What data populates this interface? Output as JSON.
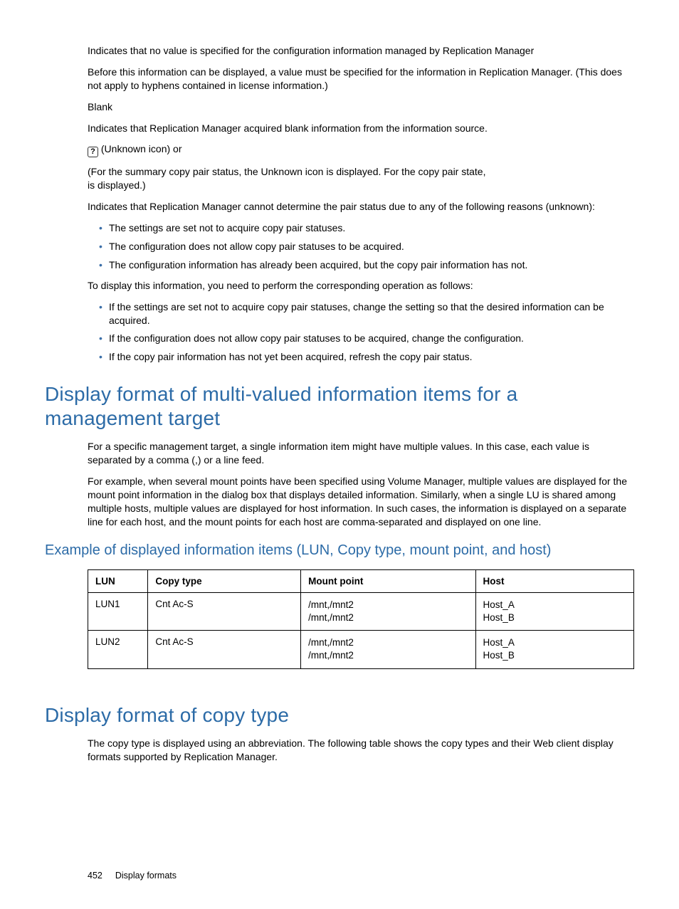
{
  "intro": {
    "p1": "Indicates that no value is specified for the configuration information managed by Replication Manager",
    "p2": "Before this information can be displayed, a value must be specified for the information in Replication Manager. (This does not apply to hyphens contained in license information.)",
    "p3": "Blank",
    "p4": "Indicates that Replication Manager acquired blank information from the information source.",
    "iconSuffix": " (Unknown icon) or",
    "p5b": "(For the summary copy pair status, the Unknown icon is displayed. For the copy pair state,",
    "p5c": "is displayed.)",
    "p6": "Indicates that Replication Manager cannot determine the pair status due to any of the following reasons (unknown):",
    "bullets1": [
      "The settings are set not to acquire copy pair statuses.",
      "The configuration does not allow copy pair statuses to be acquired.",
      "The configuration information has already been acquired, but the copy pair information has not."
    ],
    "p7": "To display this information, you need to perform the corresponding operation as follows:",
    "bullets2": [
      "If the settings are set not to acquire copy pair statuses, change the setting so that the desired information can be acquired.",
      "If the configuration does not allow copy pair statuses to be acquired, change the configuration.",
      "If the copy pair information has not yet been acquired, refresh the copy pair status."
    ]
  },
  "h1": "Display format of multi-valued information items for a management target",
  "sec1": {
    "p1": "For a specific management target, a single information item might have multiple values. In this case, each value is separated by a comma (,) or a line feed.",
    "p2": "For example, when several mount points have been specified using Volume Manager, multiple values are displayed for the mount point information in the dialog box that displays detailed information. Similarly, when a single LU is shared among multiple hosts, multiple values are displayed for host information. In such cases, the information is displayed on a separate line for each host, and the mount points for each host are comma-separated and displayed on one line."
  },
  "h2": "Example of displayed information items (LUN, Copy type, mount point, and host)",
  "table": {
    "headers": [
      "LUN",
      "Copy type",
      "Mount point",
      "Host"
    ],
    "rows": [
      {
        "lun": "LUN1",
        "copy": "Cnt Ac-S",
        "mount1": "/mnt,/mnt2",
        "mount2": "/mnt,/mnt2",
        "host1": "Host_A",
        "host2": "Host_B"
      },
      {
        "lun": "LUN2",
        "copy": "Cnt Ac-S",
        "mount1": "/mnt,/mnt2",
        "mount2": "/mnt,/mnt2",
        "host1": "Host_A",
        "host2": "Host_B"
      }
    ]
  },
  "h1b": "Display format of copy type",
  "sec2": {
    "p1": "The copy type is displayed using an abbreviation. The following table shows the copy types and their Web client display formats supported by Replication Manager."
  },
  "footer": {
    "pageNum": "452",
    "section": "Display formats"
  }
}
